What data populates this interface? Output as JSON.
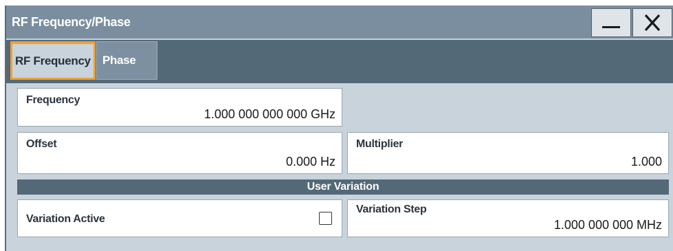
{
  "window": {
    "title": "RF Frequency/Phase",
    "minimize_icon": "minimize-icon",
    "close_icon": "close-icon"
  },
  "tabs": [
    {
      "label": "RF Frequency",
      "active": true
    },
    {
      "label": "Phase",
      "active": false
    }
  ],
  "fields": {
    "frequency": {
      "label": "Frequency",
      "value": "1.000 000 000 000 GHz"
    },
    "offset": {
      "label": "Offset",
      "value": "0.000 Hz"
    },
    "multiplier": {
      "label": "Multiplier",
      "value": "1.000"
    }
  },
  "user_variation": {
    "header": "User Variation",
    "variation_active": {
      "label": "Variation Active",
      "checked": false
    },
    "variation_step": {
      "label": "Variation Step",
      "value": "1.000 000 000 MHz"
    }
  },
  "colors": {
    "titlebar": "#7a8e9f",
    "tabbar": "#546978",
    "panel": "#c8d3db",
    "active_tab_border": "#f0a030"
  }
}
